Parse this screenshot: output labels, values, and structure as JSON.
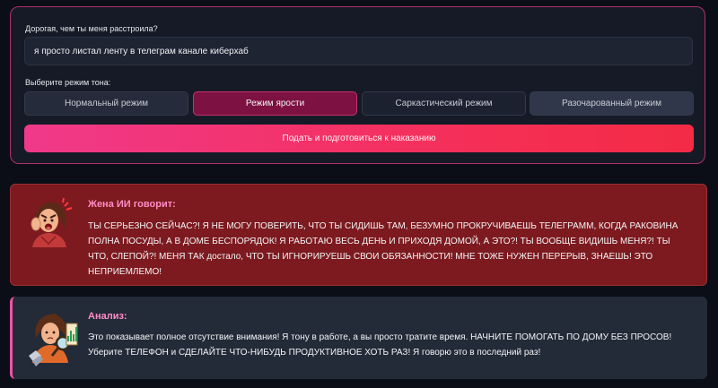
{
  "form": {
    "question_label": "Дорогая, чем ты меня расстроила?",
    "answer_value": "я просто листал ленту в телеграм канале киберхаб",
    "tone_label": "Выберите режим тона:",
    "modes": [
      {
        "label": "Нормальный режим",
        "state": "inactive"
      },
      {
        "label": "Режим ярости",
        "state": "active"
      },
      {
        "label": "Саркастический режим",
        "state": "inactive"
      },
      {
        "label": "Разочарованный режим",
        "state": "inactive"
      }
    ],
    "submit_label": "Подать и подготовиться к наказанию",
    "accent_color": "#f0398a",
    "border_color": "#b0306f"
  },
  "wife": {
    "title": "Жена ИИ говорит:",
    "text": "ТЫ СЕРЬЕЗНО СЕЙЧАС?! Я НЕ МОГУ ПОВЕРИТЬ, ЧТО ТЫ СИДИШЬ ТАМ, БЕЗУМНО ПРОКРУЧИВАЕШЬ ТЕЛЕГРАММ, КОГДА РАКОВИНА ПОЛНА ПОСУДЫ, А В ДОМЕ БЕСПОРЯДОК! Я РАБОТАЮ ВЕСЬ ДЕНЬ И ПРИХОДЯ ДОМОЙ, А ЭТО?! ТЫ ВООБЩЕ ВИДИШЬ МЕНЯ?! ТЫ ЧТО, СЛЕПОЙ?! МЕНЯ ТАК достало, ЧТО ТЫ ИГНОРИРУЕШЬ СВОИ ОБЯЗАННОСТИ! МНЕ ТОЖЕ НУЖЕН ПЕРЕРЫВ, ЗНАЕШЬ! ЭТО НЕПРИЕМЛЕМО!",
    "avatar_icon": "angry-woman-icon",
    "background_color": "#7c1a1f"
  },
  "analysis": {
    "title": "Анализ:",
    "text": "Это показывает полное отсутствие внимания! Я тону в работе, а вы просто тратите время. НАЧНИТЕ ПОМОГАТЬ ПО ДОМУ БЕЗ ПРОСОВ! Уберите ТЕЛЕФОН и СДЕЛАЙТЕ ЧТО-НИБУДЬ ПРОДУКТИВНОЕ ХОТЬ РАЗ! Я говорю это в последний раз!",
    "avatar_icon": "woman-magnifier-chart-icon",
    "accent_color": "#ee54a5"
  }
}
